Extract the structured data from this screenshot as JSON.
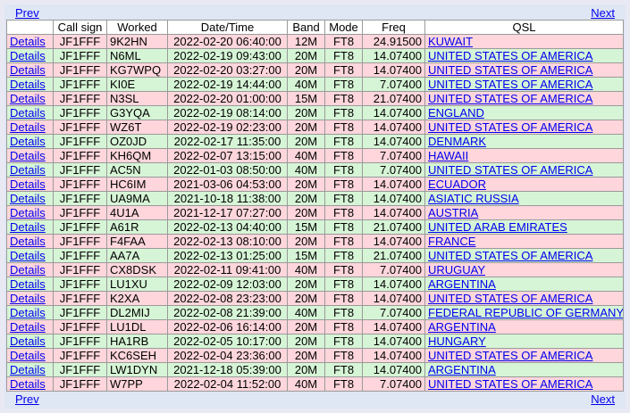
{
  "nav": {
    "prev_label": "Prev",
    "next_label": "Next"
  },
  "columns": [
    "",
    "Call sign",
    "Worked",
    "Date/Time",
    "Band",
    "Mode",
    "Freq",
    "QSL"
  ],
  "colors": {
    "pink": "#ffd6dc",
    "green": "#d6f5d6",
    "link": "#0000ee"
  },
  "rows": [
    {
      "details": "Details",
      "call": "JF1FFF",
      "worked": "9K2HN",
      "datetime": "2022-02-20 06:40:00",
      "band": "12M",
      "mode": "FT8",
      "freq": "24.91500",
      "qsl": "KUWAIT",
      "style": "pink"
    },
    {
      "details": "Details",
      "call": "JF1FFF",
      "worked": "N6ML",
      "datetime": "2022-02-19 09:43:00",
      "band": "20M",
      "mode": "FT8",
      "freq": "14.07400",
      "qsl": "UNITED STATES OF AMERICA",
      "style": "green"
    },
    {
      "details": "Details",
      "call": "JF1FFF",
      "worked": "KG7WPQ",
      "datetime": "2022-02-20 03:27:00",
      "band": "20M",
      "mode": "FT8",
      "freq": "14.07400",
      "qsl": "UNITED STATES OF AMERICA",
      "style": "pink"
    },
    {
      "details": "Details",
      "call": "JF1FFF",
      "worked": "KI0E",
      "datetime": "2022-02-19 14:44:00",
      "band": "40M",
      "mode": "FT8",
      "freq": "7.07400",
      "qsl": "UNITED STATES OF AMERICA",
      "style": "green"
    },
    {
      "details": "Details",
      "call": "JF1FFF",
      "worked": "N3SL",
      "datetime": "2022-02-20 01:00:00",
      "band": "15M",
      "mode": "FT8",
      "freq": "21.07400",
      "qsl": "UNITED STATES OF AMERICA",
      "style": "pink"
    },
    {
      "details": "Details",
      "call": "JF1FFF",
      "worked": "G3YQA",
      "datetime": "2022-02-19 08:14:00",
      "band": "20M",
      "mode": "FT8",
      "freq": "14.07400",
      "qsl": "ENGLAND",
      "style": "green"
    },
    {
      "details": "Details",
      "call": "JF1FFF",
      "worked": "WZ6T",
      "datetime": "2022-02-19 02:23:00",
      "band": "20M",
      "mode": "FT8",
      "freq": "14.07400",
      "qsl": "UNITED STATES OF AMERICA",
      "style": "pink"
    },
    {
      "details": "Details",
      "call": "JF1FFF",
      "worked": "OZ0JD",
      "datetime": "2022-02-17 11:35:00",
      "band": "20M",
      "mode": "FT8",
      "freq": "14.07400",
      "qsl": "DENMARK",
      "style": "green"
    },
    {
      "details": "Details",
      "call": "JF1FFF",
      "worked": "KH6QM",
      "datetime": "2022-02-07 13:15:00",
      "band": "40M",
      "mode": "FT8",
      "freq": "7.07400",
      "qsl": "HAWAII",
      "style": "pink"
    },
    {
      "details": "Details",
      "call": "JF1FFF",
      "worked": "AC5N",
      "datetime": "2022-01-03 08:50:00",
      "band": "40M",
      "mode": "FT8",
      "freq": "7.07400",
      "qsl": "UNITED STATES OF AMERICA",
      "style": "green"
    },
    {
      "details": "Details",
      "call": "JF1FFF",
      "worked": "HC6IM",
      "datetime": "2021-03-06 04:53:00",
      "band": "20M",
      "mode": "FT8",
      "freq": "14.07400",
      "qsl": "ECUADOR",
      "style": "pink"
    },
    {
      "details": "Details",
      "call": "JF1FFF",
      "worked": "UA9MA",
      "datetime": "2021-10-18 11:38:00",
      "band": "20M",
      "mode": "FT8",
      "freq": "14.07400",
      "qsl": "ASIATIC RUSSIA",
      "style": "green"
    },
    {
      "details": "Details",
      "call": "JF1FFF",
      "worked": "4U1A",
      "datetime": "2021-12-17 07:27:00",
      "band": "20M",
      "mode": "FT8",
      "freq": "14.07400",
      "qsl": "AUSTRIA",
      "style": "pink"
    },
    {
      "details": "Details",
      "call": "JF1FFF",
      "worked": "A61R",
      "datetime": "2022-02-13 04:40:00",
      "band": "15M",
      "mode": "FT8",
      "freq": "21.07400",
      "qsl": "UNITED ARAB EMIRATES",
      "style": "green"
    },
    {
      "details": "Details",
      "call": "JF1FFF",
      "worked": "F4FAA",
      "datetime": "2022-02-13 08:10:00",
      "band": "20M",
      "mode": "FT8",
      "freq": "14.07400",
      "qsl": "FRANCE",
      "style": "pink"
    },
    {
      "details": "Details",
      "call": "JF1FFF",
      "worked": "AA7A",
      "datetime": "2022-02-13 01:25:00",
      "band": "15M",
      "mode": "FT8",
      "freq": "21.07400",
      "qsl": "UNITED STATES OF AMERICA",
      "style": "green"
    },
    {
      "details": "Details",
      "call": "JF1FFF",
      "worked": "CX8DSK",
      "datetime": "2022-02-11 09:41:00",
      "band": "40M",
      "mode": "FT8",
      "freq": "7.07400",
      "qsl": "URUGUAY",
      "style": "pink"
    },
    {
      "details": "Details",
      "call": "JF1FFF",
      "worked": "LU1XU",
      "datetime": "2022-02-09 12:03:00",
      "band": "20M",
      "mode": "FT8",
      "freq": "14.07400",
      "qsl": "ARGENTINA",
      "style": "green"
    },
    {
      "details": "Details",
      "call": "JF1FFF",
      "worked": "K2XA",
      "datetime": "2022-02-08 23:23:00",
      "band": "20M",
      "mode": "FT8",
      "freq": "14.07400",
      "qsl": "UNITED STATES OF AMERICA",
      "style": "pink"
    },
    {
      "details": "Details",
      "call": "JF1FFF",
      "worked": "DL2MIJ",
      "datetime": "2022-02-08 21:39:00",
      "band": "40M",
      "mode": "FT8",
      "freq": "7.07400",
      "qsl": "FEDERAL REPUBLIC OF GERMANY",
      "style": "green"
    },
    {
      "details": "Details",
      "call": "JF1FFF",
      "worked": "LU1DL",
      "datetime": "2022-02-06 16:14:00",
      "band": "20M",
      "mode": "FT8",
      "freq": "14.07400",
      "qsl": "ARGENTINA",
      "style": "pink"
    },
    {
      "details": "Details",
      "call": "JF1FFF",
      "worked": "HA1RB",
      "datetime": "2022-02-05 10:17:00",
      "band": "20M",
      "mode": "FT8",
      "freq": "14.07400",
      "qsl": "HUNGARY",
      "style": "green"
    },
    {
      "details": "Details",
      "call": "JF1FFF",
      "worked": "KC6SEH",
      "datetime": "2022-02-04 23:36:00",
      "band": "20M",
      "mode": "FT8",
      "freq": "14.07400",
      "qsl": "UNITED STATES OF AMERICA",
      "style": "pink"
    },
    {
      "details": "Details",
      "call": "JF1FFF",
      "worked": "LW1DYN",
      "datetime": "2021-12-18 05:39:00",
      "band": "20M",
      "mode": "FT8",
      "freq": "14.07400",
      "qsl": "ARGENTINA",
      "style": "green"
    },
    {
      "details": "Details",
      "call": "JF1FFF",
      "worked": "W7PP",
      "datetime": "2022-02-04 11:52:00",
      "band": "40M",
      "mode": "FT8",
      "freq": "7.07400",
      "qsl": "UNITED STATES OF AMERICA",
      "style": "pink"
    }
  ]
}
